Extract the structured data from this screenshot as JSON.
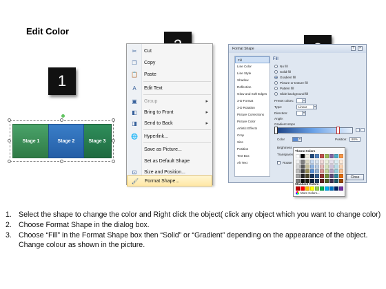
{
  "title": "Edit Color",
  "badges": [
    "1",
    "2",
    "3"
  ],
  "stages": [
    "Stage 1",
    "Stage 2",
    "Stage 3"
  ],
  "context_menu": {
    "items": [
      {
        "label": "Cut",
        "icon": "scissors-icon",
        "enabled": true
      },
      {
        "label": "Copy",
        "icon": "copy-icon",
        "enabled": true
      },
      {
        "label": "Paste",
        "icon": "paste-icon",
        "enabled": true
      },
      {
        "label": "Edit Text",
        "icon": "edit-text-icon",
        "enabled": true
      },
      {
        "label": "Group",
        "icon": "group-icon",
        "enabled": false,
        "submenu": true
      },
      {
        "label": "Bring to Front",
        "icon": "bring-front-icon",
        "enabled": true,
        "submenu": true
      },
      {
        "label": "Send to Back",
        "icon": "send-back-icon",
        "enabled": true,
        "submenu": true
      },
      {
        "label": "Hyperlink...",
        "icon": "hyperlink-icon",
        "enabled": true
      },
      {
        "label": "Save as Picture...",
        "icon": "",
        "enabled": true
      },
      {
        "label": "Set as Default Shape",
        "icon": "",
        "enabled": true
      },
      {
        "label": "Size and Position...",
        "icon": "size-position-icon",
        "enabled": true
      },
      {
        "label": "Format Shape...",
        "icon": "format-shape-icon",
        "enabled": true,
        "highlighted": true
      }
    ]
  },
  "dialog": {
    "title": "Format Shape",
    "left_items": [
      "Fill",
      "Line Color",
      "Line Style",
      "Shadow",
      "Reflection",
      "Glow and Soft Edges",
      "3-D Format",
      "3-D Rotation",
      "Picture Corrections",
      "Picture Color",
      "Artistic Effects",
      "Crop",
      "Size",
      "Position",
      "Text Box",
      "Alt Text"
    ],
    "selected_left": "Fill",
    "section": "Fill",
    "fill_options": [
      "No fill",
      "Solid fill",
      "Gradient fill",
      "Picture or texture fill",
      "Pattern fill",
      "Slide background fill"
    ],
    "selected_fill": "Gradient fill",
    "fields": {
      "preset_label": "Preset colors:",
      "type_label": "Type:",
      "type_value": "Linear",
      "direction_label": "Direction:",
      "angle_label": "Angle:",
      "angle_value": "135°",
      "stops_label": "Gradient stops",
      "color_label": "Color",
      "position_label": "Position:",
      "position_value": "80%",
      "brightness_label": "Brightness",
      "transparency_label": "Transparency",
      "rotate_label": "Rotate"
    },
    "close_label": "Close"
  },
  "palette": {
    "theme_header": "Theme Colors",
    "standard_header": "Standard Colors",
    "more_label": "More Colors...",
    "theme_top": [
      "#ffffff",
      "#000000",
      "#eeece1",
      "#1f497d",
      "#4f81bd",
      "#c0504d",
      "#9bbb59",
      "#8064a2",
      "#4bacc6",
      "#f79646"
    ],
    "theme_rows": [
      [
        "#f2f2f2",
        "#7f7f7f",
        "#ddd9c3",
        "#c6d9f0",
        "#dbe5f1",
        "#f2dcdb",
        "#ebf1dd",
        "#e5e0ec",
        "#dbeef3",
        "#fdeada"
      ],
      [
        "#d8d8d8",
        "#595959",
        "#c4bd97",
        "#8db3e2",
        "#b8cce4",
        "#e5b9b7",
        "#d7e3bc",
        "#ccc1d9",
        "#b7dde8",
        "#fbd5b5"
      ],
      [
        "#bfbfbf",
        "#3f3f3f",
        "#938953",
        "#548dd4",
        "#95b3d7",
        "#d99694",
        "#c3d69b",
        "#b2a2c7",
        "#92cddc",
        "#fac08f"
      ],
      [
        "#a5a5a5",
        "#262626",
        "#494429",
        "#17365d",
        "#366092",
        "#953734",
        "#76923c",
        "#5f497a",
        "#31859b",
        "#e36c09"
      ],
      [
        "#7f7f7f",
        "#0c0c0c",
        "#1d1b10",
        "#0f243e",
        "#244061",
        "#632423",
        "#4f6128",
        "#3f3151",
        "#205867",
        "#974806"
      ]
    ],
    "standard": [
      "#c00000",
      "#ff0000",
      "#ffc000",
      "#ffff00",
      "#92d050",
      "#00b050",
      "#00b0f0",
      "#0070c0",
      "#002060",
      "#7030a0"
    ]
  },
  "instructions": [
    {
      "num": "1.",
      "text": "Select the shape to change the color and Right click the object( click any object which you want to change color)"
    },
    {
      "num": "2.",
      "text": "Choose Format Shape in the dialog box."
    },
    {
      "num": "3.",
      "text": "Choose “Fill” in the Format Shape box then “Solid” or “Gradient” depending on the appearance of the object. Change colour as shown in the picture."
    }
  ]
}
